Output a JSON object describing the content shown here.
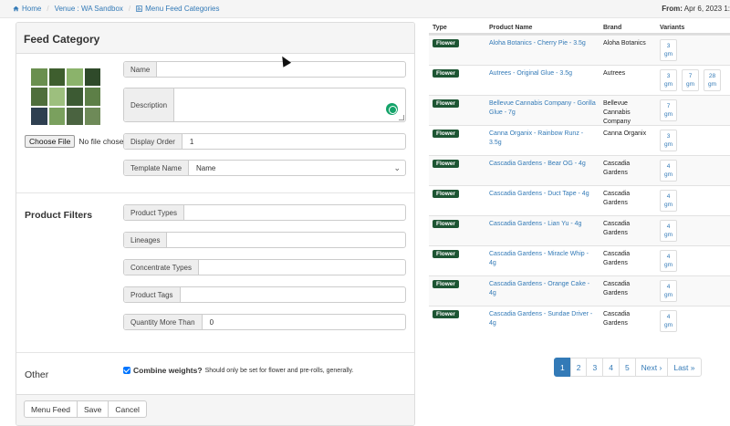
{
  "breadcrumb": [
    {
      "label": "Home",
      "icon": "home-icon"
    },
    {
      "label": "Venue : WA Sandbox"
    },
    {
      "label": "Menu Feed Categories",
      "icon": "rss-icon"
    }
  ],
  "date_range": {
    "label": "From:",
    "value": "Apr 6, 2023 1:"
  },
  "form": {
    "title": "Feed Category",
    "file": {
      "button": "Choose File",
      "status": "No file chosen"
    },
    "name": {
      "label": "Name",
      "value": ""
    },
    "description": {
      "label": "Description",
      "value": ""
    },
    "display_order": {
      "label": "Display Order",
      "value": "1"
    },
    "template_name": {
      "label": "Template Name",
      "value": "Name"
    },
    "filters_title": "Product Filters",
    "product_types": {
      "label": "Product Types",
      "value": ""
    },
    "lineages": {
      "label": "Lineages",
      "value": ""
    },
    "concentrate_types": {
      "label": "Concentrate Types",
      "value": ""
    },
    "product_tags": {
      "label": "Product Tags",
      "value": ""
    },
    "quantity_more_than": {
      "label": "Quantity More Than",
      "value": "0"
    },
    "other_title": "Other",
    "combine": {
      "label": "Combine weights?",
      "hint": "Should only be set for flower and pre-rolls, generally.",
      "checked": true
    },
    "buttons": {
      "menu_feed": "Menu Feed",
      "save": "Save",
      "cancel": "Cancel"
    }
  },
  "table": {
    "headers": {
      "type": "Type",
      "product": "Product Name",
      "brand": "Brand",
      "variants": "Variants"
    },
    "rows": [
      {
        "type": "Flower",
        "name": "Aloha Botanics - Cherry Pie - 3.5g",
        "brand": "Aloha Botanics",
        "variants": [
          {
            "qty": "3",
            "unit": "gm"
          }
        ]
      },
      {
        "type": "Flower",
        "name": "Autrees - Original Glue - 3.5g",
        "brand": "Autrees",
        "variants": [
          {
            "qty": "3",
            "unit": "gm"
          },
          {
            "qty": "7",
            "unit": "gm"
          },
          {
            "qty": "28",
            "unit": "gm"
          }
        ]
      },
      {
        "type": "Flower",
        "name": "Bellevue Cannabis Company - Gorilla Glue - 7g",
        "brand": "Bellevue Cannabis Company",
        "variants": [
          {
            "qty": "7",
            "unit": "gm"
          }
        ]
      },
      {
        "type": "Flower",
        "name": "Canna Organix - Rainbow Runz - 3.5g",
        "brand": "Canna Organix",
        "variants": [
          {
            "qty": "3",
            "unit": "gm"
          }
        ]
      },
      {
        "type": "Flower",
        "name": "Cascadia Gardens - Bear OG - 4g",
        "brand": "Cascadia Gardens",
        "variants": [
          {
            "qty": "4",
            "unit": "gm"
          }
        ]
      },
      {
        "type": "Flower",
        "name": "Cascadia Gardens - Duct Tape - 4g",
        "brand": "Cascadia Gardens",
        "variants": [
          {
            "qty": "4",
            "unit": "gm"
          }
        ]
      },
      {
        "type": "Flower",
        "name": "Cascadia Gardens - Lian Yu - 4g",
        "brand": "Cascadia Gardens",
        "variants": [
          {
            "qty": "4",
            "unit": "gm"
          }
        ]
      },
      {
        "type": "Flower",
        "name": "Cascadia Gardens - Miracle Whip - 4g",
        "brand": "Cascadia Gardens",
        "variants": [
          {
            "qty": "4",
            "unit": "gm"
          }
        ]
      },
      {
        "type": "Flower",
        "name": "Cascadia Gardens - Orange Cake - 4g",
        "brand": "Cascadia Gardens",
        "variants": [
          {
            "qty": "4",
            "unit": "gm"
          }
        ]
      },
      {
        "type": "Flower",
        "name": "Cascadia Gardens - Sundae Driver - 4g",
        "brand": "Cascadia Gardens",
        "variants": [
          {
            "qty": "4",
            "unit": "gm"
          }
        ]
      }
    ]
  },
  "pagination": {
    "pages": [
      "1",
      "2",
      "3",
      "4",
      "5"
    ],
    "active": "1",
    "next": "Next ›",
    "last": "Last »"
  },
  "colors": {
    "accent": "#337ab7",
    "badge": "#1d5533"
  }
}
